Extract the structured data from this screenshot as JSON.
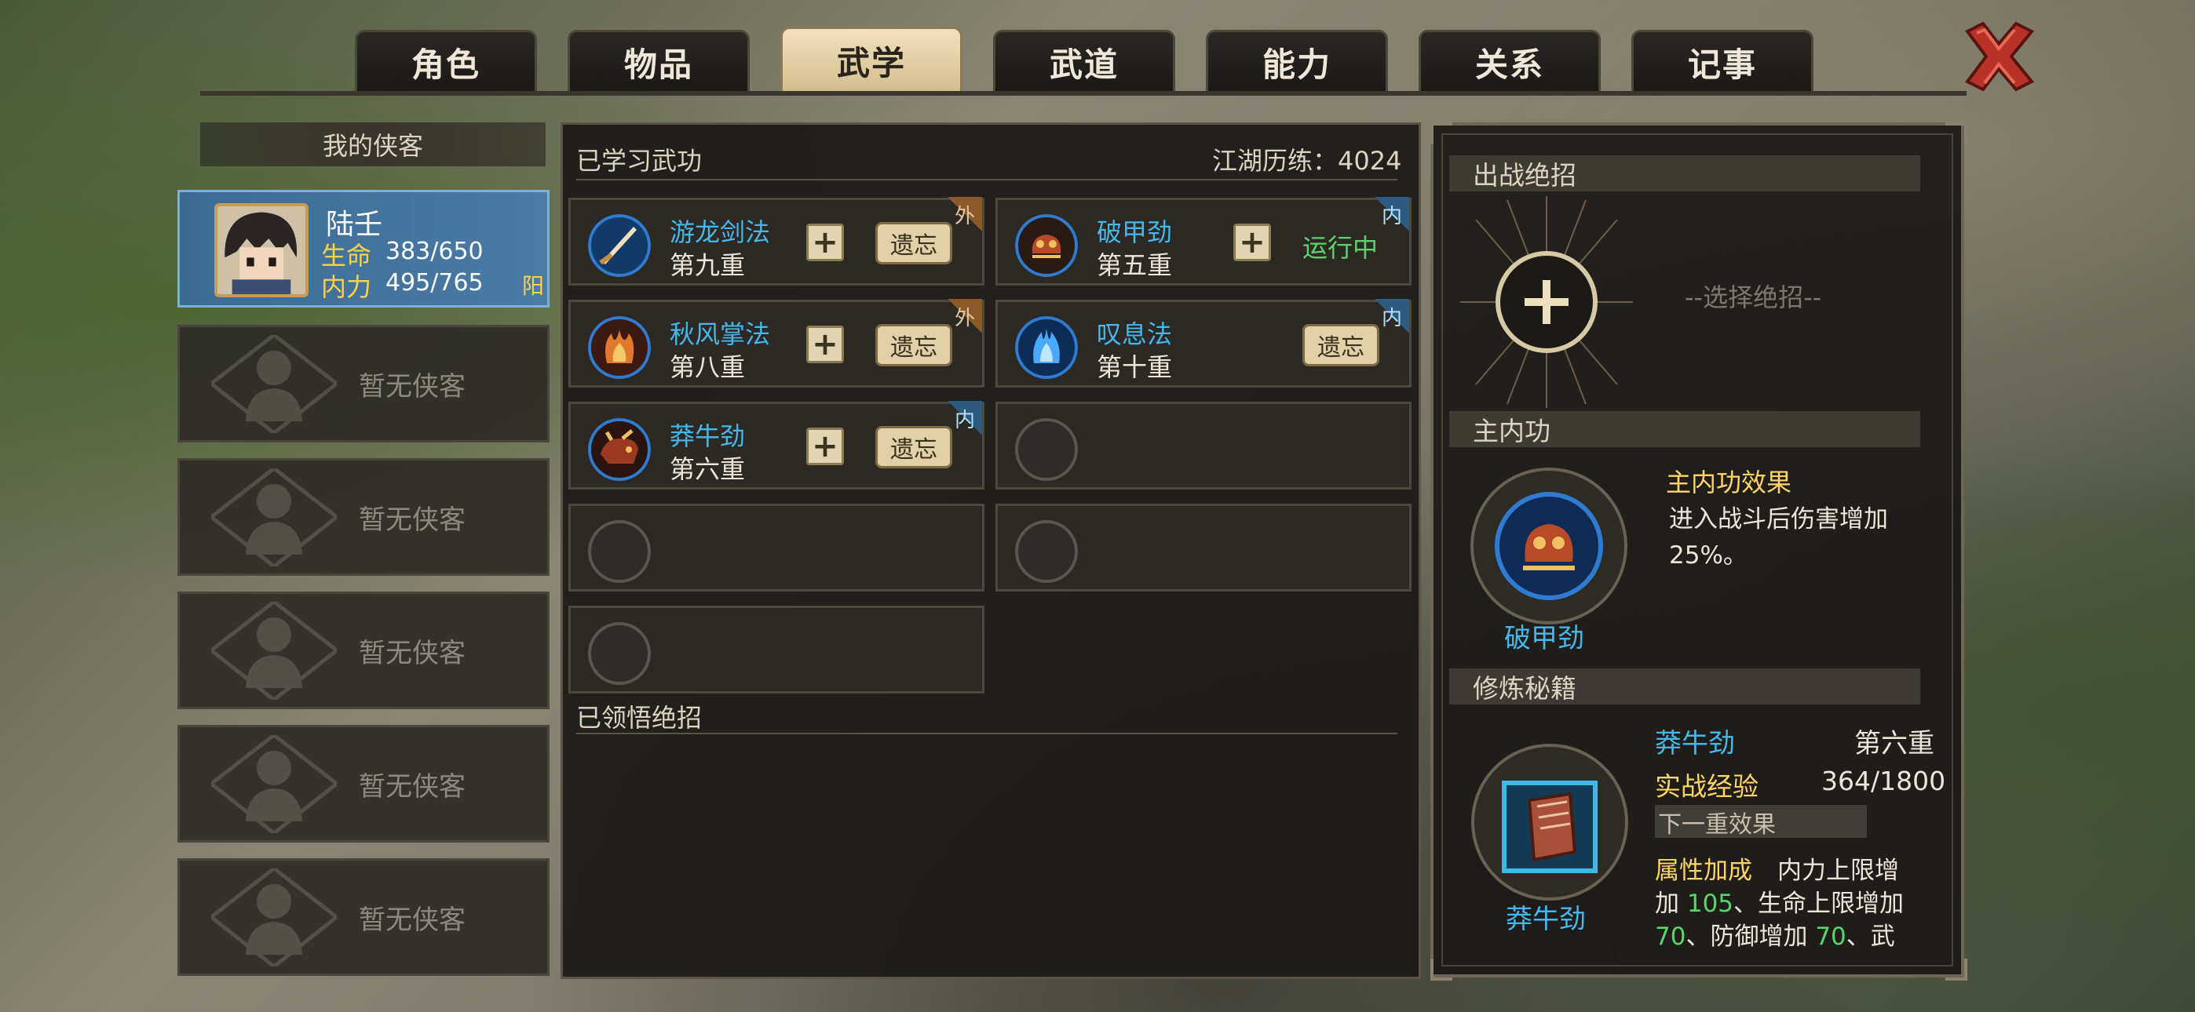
{
  "tabs": [
    {
      "label": "角色"
    },
    {
      "label": "物品"
    },
    {
      "label": "武学"
    },
    {
      "label": "武道"
    },
    {
      "label": "能力"
    },
    {
      "label": "关系"
    },
    {
      "label": "记事"
    }
  ],
  "active_tab": "武学",
  "left": {
    "header": "我的侠客",
    "hero": {
      "name": "陆壬",
      "hp_label": "生命",
      "hp": "383/650",
      "mp_label": "内力",
      "mp": "495/765",
      "tag": "阳"
    },
    "empty_slot_label": "暂无侠客"
  },
  "middle": {
    "learned_title": "已学习武功",
    "experience_label": "江湖历练：4024",
    "skills": [
      {
        "name": "游龙剑法",
        "level": "第九重",
        "badge": "外",
        "action": "遗忘",
        "status": ""
      },
      {
        "name": "破甲劲",
        "level": "第五重",
        "badge": "内",
        "action": "",
        "status": "运行中"
      },
      {
        "name": "秋风掌法",
        "level": "第八重",
        "badge": "外",
        "action": "遗忘",
        "status": ""
      },
      {
        "name": "叹息法",
        "level": "第十重",
        "badge": "内",
        "action": "遗忘",
        "status": ""
      },
      {
        "name": "莽牛劲",
        "level": "第六重",
        "badge": "内",
        "action": "遗忘",
        "status": ""
      }
    ],
    "plus_symbol": "+",
    "insight_title": "已领悟绝招"
  },
  "right": {
    "ultimate_title": "出战绝招",
    "select_placeholder": "--选择绝招--",
    "main_inner_title": "主内功",
    "main_inner_effect_title": "主内功效果",
    "main_inner_effect_l1": "进入战斗后伤害增加",
    "main_inner_effect_l2": "25%。",
    "main_inner_name": "破甲劲",
    "training_title": "修炼秘籍",
    "training_skill": "莽牛劲",
    "training_level": "第六重",
    "exp_label": "实战经验",
    "exp_value": "364/1800",
    "next_effect_title": "下一重效果",
    "attr_label": "属性加成",
    "attr_l1a": "内力上限增",
    "attr_l2a": "加 ",
    "attr_n1": "105",
    "attr_l2b": "、生命上限增加",
    "attr_n2": "70",
    "attr_l3a": "、防御增加 ",
    "attr_n3": "70",
    "attr_l3b": "、武",
    "book_name": "莽牛劲"
  },
  "colors": {
    "skill_name": "#46b7ea",
    "running": "#5ad46a",
    "hero_stat": "#ffd24a",
    "number_green": "#5ad46a"
  }
}
